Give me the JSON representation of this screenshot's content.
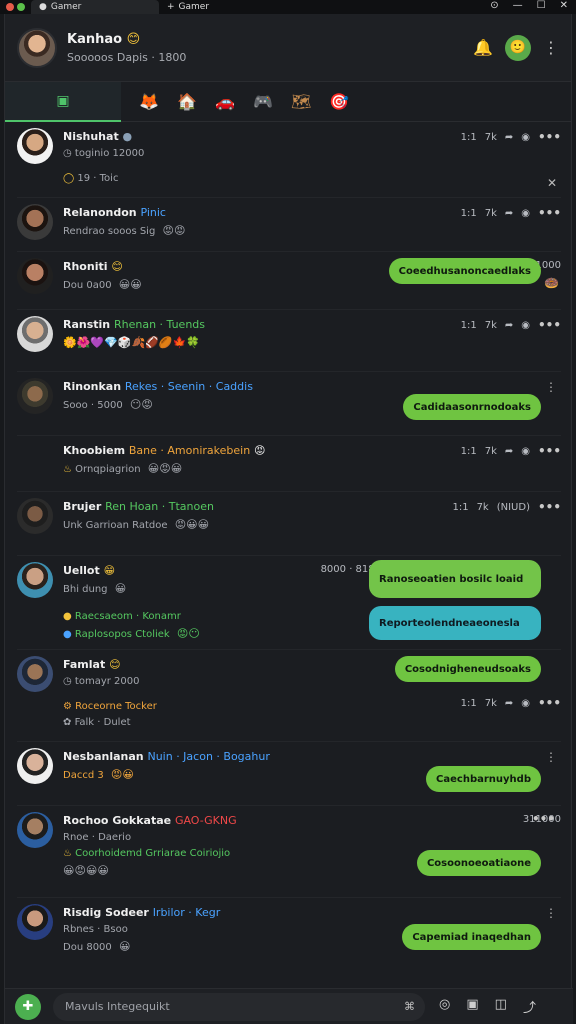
{
  "window": {
    "tab_label_1": "Gamer",
    "tab_label_2": "Gamer",
    "new_tab_symbol": "+"
  },
  "header": {
    "name": "Kanhao",
    "name_badge": "😊",
    "subtitle": "Sooooos",
    "subtitle_extra": "Dapis · 1800"
  },
  "nav": {
    "home_icon": "▣",
    "items": [
      "🦊",
      "🏠",
      "🚗",
      "🎮",
      "🗺",
      "🎯"
    ]
  },
  "feed": [
    {
      "name": "Nishuhat",
      "tag": "",
      "sub": "toginio 12000",
      "time": "1:1",
      "count": "7k",
      "extra_line": "19 · Toic",
      "bubble": ""
    },
    {
      "name": "Relanondon",
      "tag": "Pinic",
      "sub": "Rendrao sooos Sig",
      "time": "1:1",
      "count": "7k",
      "extra_line": "",
      "bubble": ""
    },
    {
      "name": "Rhoniti",
      "tag": "",
      "sub": "Dou 0a00",
      "time": "331000",
      "count": "",
      "extra_line": "",
      "bubble": "Coeedhusanoncaedlaks"
    },
    {
      "name": "Ranstin",
      "tag": "Rhenan · Tuends",
      "sub": "",
      "time": "1:1",
      "count": "7k",
      "extra_line": "",
      "bubble": ""
    },
    {
      "name": "Rinonkan",
      "tag": "Rekes · Seenin · Caddis",
      "sub": "Sooo · 5000",
      "time": "",
      "count": "",
      "extra_line": "",
      "bubble": "Cadidaasonrnodoaks"
    },
    {
      "name": "Khoobiem",
      "tag": "Bane · Amonirakebein",
      "sub": "Ornqpiagrion",
      "time": "1:1",
      "count": "7k",
      "extra_line": "",
      "bubble": ""
    },
    {
      "name": "Brujer",
      "tag": "Ren Hoan · Ttanoen",
      "sub": "Unk Garrioan Ratdoe",
      "time": "1:1",
      "count": "7k",
      "extra_line": "(NIUD)",
      "bubble": ""
    },
    {
      "name": "Uellot",
      "tag": "",
      "sub": "Bhi dung",
      "time": "8000 · 8180",
      "count": "",
      "extra_line": "Raecsaeom · Konamr",
      "bubble": "Ranoseoatien bosilc loaid"
    },
    {
      "name": "Famlat",
      "tag": "",
      "sub": "tomayr 2000",
      "time": "1:1",
      "count": "7k",
      "extra_line": "Roceorne Tocker",
      "bubble": "Cosodnigheneudsoaks"
    },
    {
      "name": "Nesbanlanan",
      "tag": "Nuin · Jacon · Bogahur",
      "sub": "Daccd 3",
      "time": "",
      "count": "",
      "extra_line": "",
      "bubble": "Caechbarnuyhdb"
    },
    {
      "name": "Rochoo Gokkatae",
      "tag": "GAO-GKNG",
      "sub": "Rnoe · Daerio",
      "time": "311000",
      "count": "",
      "extra_line": "Coorhoidemd Grriarae Coiriojio",
      "bubble": "Cosoonoeoatiaone"
    },
    {
      "name": "Risdig Sodeer",
      "tag": "Irbilor · Kegr",
      "sub": "Rbnes · Bsoo",
      "time": "",
      "count": "",
      "extra_line": "Dou 8000",
      "bubble": "Capemiad inaqedhan"
    }
  ],
  "composer": {
    "placeholder": "Mavuls Integequikt",
    "gif_label": "⌘"
  },
  "colors": {
    "accent": "#4fc46a",
    "bubble_green": "#6fc441",
    "bubble_teal": "#38b3c0"
  }
}
